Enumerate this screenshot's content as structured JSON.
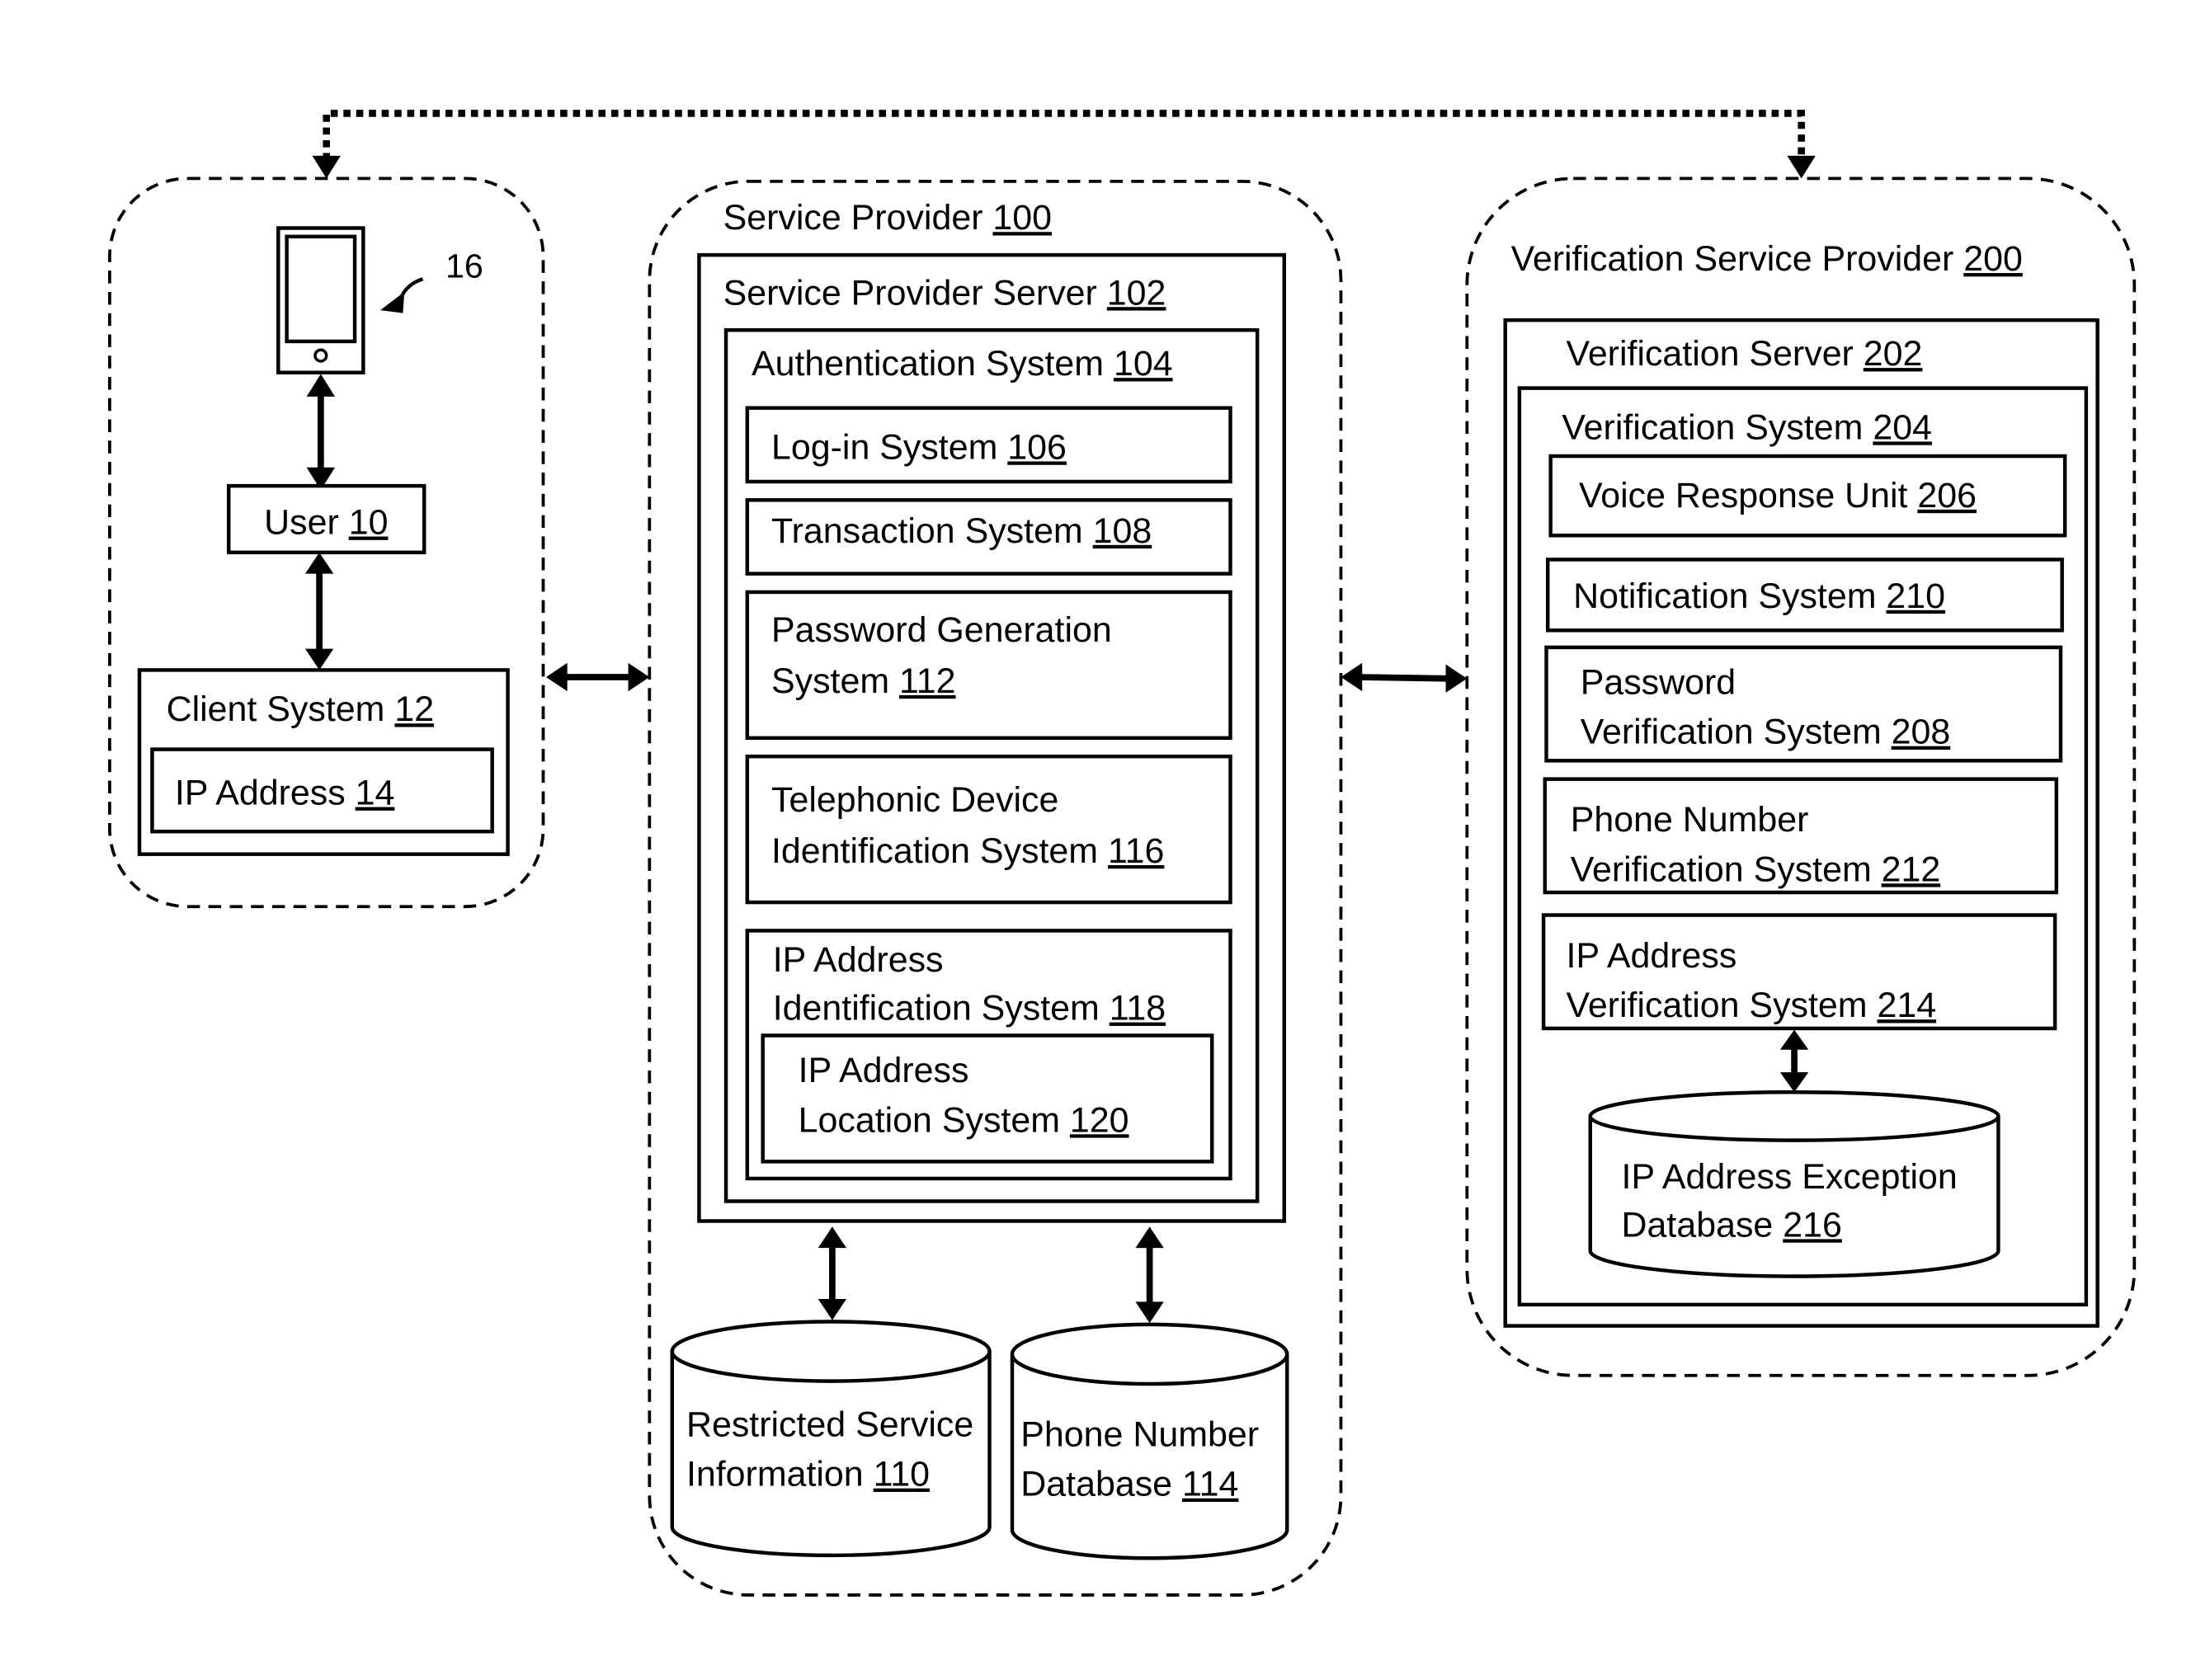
{
  "client_group": {
    "device_ref": "16",
    "user": {
      "label": "User",
      "num": "10"
    },
    "client_system": {
      "label": "Client System",
      "num": "12"
    },
    "ip_address": {
      "label": "IP Address",
      "num": "14"
    }
  },
  "service_provider": {
    "title": {
      "label": "Service Provider",
      "num": "100"
    },
    "server": {
      "label": "Service Provider Server",
      "num": "102"
    },
    "auth": {
      "label": "Authentication System",
      "num": "104"
    },
    "login": {
      "label": "Log-in System",
      "num": "106"
    },
    "transaction": {
      "label": "Transaction System",
      "num": "108"
    },
    "password_gen": {
      "line1": "Password Generation",
      "line2": "System",
      "num": "112"
    },
    "telephonic": {
      "line1": "Telephonic Device",
      "line2": "Identification System",
      "num": "116"
    },
    "ip_ident": {
      "line1": "IP Address",
      "line2": "Identification System",
      "num": "118"
    },
    "ip_location": {
      "line1": "IP Address",
      "line2": "Location System",
      "num": "120"
    },
    "restricted_db": {
      "line1": "Restricted Service",
      "line2": "Information",
      "num": "110"
    },
    "phone_db": {
      "line1": "Phone Number",
      "line2": "Database",
      "num": "114"
    }
  },
  "verification_provider": {
    "title": {
      "label": "Verification Service Provider",
      "num": "200"
    },
    "server": {
      "label": "Verification Server",
      "num": "202"
    },
    "system": {
      "label": "Verification System",
      "num": "204"
    },
    "voice": {
      "label": "Voice Response Unit",
      "num": "206"
    },
    "notification": {
      "label": "Notification System",
      "num": "210"
    },
    "password_ver": {
      "line1": "Password",
      "line2": "Verification System",
      "num": "208"
    },
    "phone_ver": {
      "line1": "Phone Number",
      "line2": "Verification System",
      "num": "212"
    },
    "ip_ver": {
      "line1": "IP Address",
      "line2": "Verification System",
      "num": "214"
    },
    "ip_exception_db": {
      "line1": "IP Address Exception",
      "line2": "Database",
      "num": "216"
    }
  }
}
